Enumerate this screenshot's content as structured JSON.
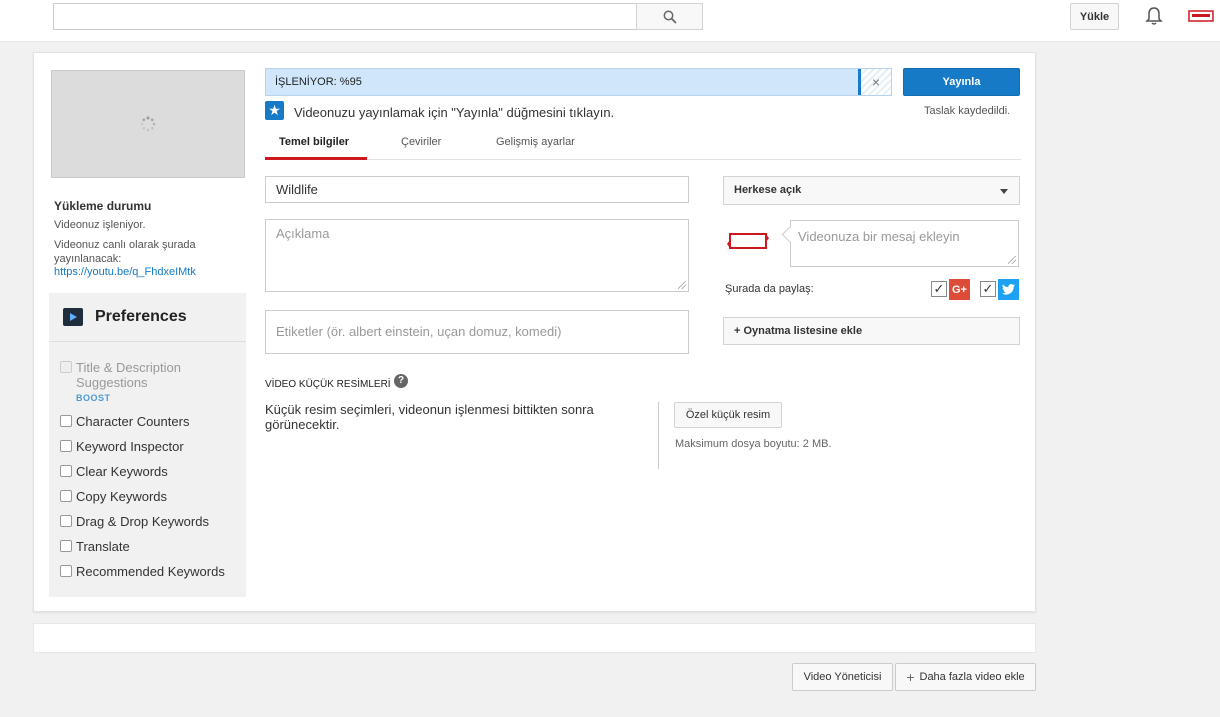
{
  "header": {
    "search_placeholder": "",
    "upload_label": "Yükle"
  },
  "upload": {
    "status_title": "Yükleme durumu",
    "processing_text": "Videonuz işleniyor.",
    "live_text": "Videonuz canlı olarak şurada yayınlanacak:",
    "link": "https://youtu.be/q_FhdxeIMtk"
  },
  "preferences": {
    "title": "Preferences",
    "items": [
      {
        "label": "Title & Description Suggestions",
        "badge": "BOOST",
        "disabled": true
      },
      {
        "label": "Character Counters"
      },
      {
        "label": "Keyword Inspector"
      },
      {
        "label": "Clear Keywords"
      },
      {
        "label": "Copy Keywords"
      },
      {
        "label": "Drag & Drop Keywords"
      },
      {
        "label": "Translate"
      },
      {
        "label": "Recommended Keywords"
      }
    ]
  },
  "progress": {
    "label": "İŞLENİYOR: %95",
    "percent": 95
  },
  "publish": {
    "button": "Yayınla",
    "draft_saved": "Taslak kaydedildi.",
    "info": "Videonuzu yayınlamak için \"Yayınla\" düğmesini tıklayın."
  },
  "tabs": [
    "Temel bilgiler",
    "Çeviriler",
    "Gelişmiş ayarlar"
  ],
  "form": {
    "title_value": "Wildlife",
    "description_placeholder": "Açıklama",
    "tags_placeholder": "Etiketler (ör. albert einstein, uçan domuz, komedi)",
    "privacy_value": "Herkese açık",
    "message_placeholder": "Videonuza bir mesaj ekleyin",
    "share_label": "Şurada da paylaş:",
    "gplus_label": "G+",
    "playlist_button": "+ Oynatma listesine ekle"
  },
  "thumbnails": {
    "title": "VİDEO KÜÇÜK RESİMLERİ",
    "note": "Küçük resim seçimleri, videonun işlenmesi bittikten sonra görünecektir.",
    "custom_button": "Özel küçük resim",
    "max_size": "Maksimum dosya boyutu: 2 MB."
  },
  "footer": {
    "video_manager": "Video Yöneticisi",
    "add_more": "Daha fazla video ekle"
  },
  "colors": {
    "accent": "#167ac6",
    "tab_active": "#cc181e",
    "progress_bg": "#cfe6fb"
  }
}
